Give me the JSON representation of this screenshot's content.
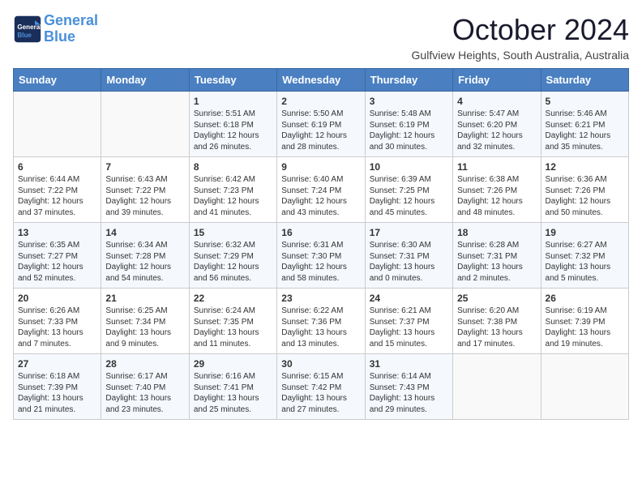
{
  "logo": {
    "line1": "General",
    "line2": "Blue"
  },
  "title": "October 2024",
  "subtitle": "Gulfview Heights, South Australia, Australia",
  "days_of_week": [
    "Sunday",
    "Monday",
    "Tuesday",
    "Wednesday",
    "Thursday",
    "Friday",
    "Saturday"
  ],
  "weeks": [
    [
      {
        "day": "",
        "info": ""
      },
      {
        "day": "",
        "info": ""
      },
      {
        "day": "1",
        "info": "Sunrise: 5:51 AM\nSunset: 6:18 PM\nDaylight: 12 hours\nand 26 minutes."
      },
      {
        "day": "2",
        "info": "Sunrise: 5:50 AM\nSunset: 6:19 PM\nDaylight: 12 hours\nand 28 minutes."
      },
      {
        "day": "3",
        "info": "Sunrise: 5:48 AM\nSunset: 6:19 PM\nDaylight: 12 hours\nand 30 minutes."
      },
      {
        "day": "4",
        "info": "Sunrise: 5:47 AM\nSunset: 6:20 PM\nDaylight: 12 hours\nand 32 minutes."
      },
      {
        "day": "5",
        "info": "Sunrise: 5:46 AM\nSunset: 6:21 PM\nDaylight: 12 hours\nand 35 minutes."
      }
    ],
    [
      {
        "day": "6",
        "info": "Sunrise: 6:44 AM\nSunset: 7:22 PM\nDaylight: 12 hours\nand 37 minutes."
      },
      {
        "day": "7",
        "info": "Sunrise: 6:43 AM\nSunset: 7:22 PM\nDaylight: 12 hours\nand 39 minutes."
      },
      {
        "day": "8",
        "info": "Sunrise: 6:42 AM\nSunset: 7:23 PM\nDaylight: 12 hours\nand 41 minutes."
      },
      {
        "day": "9",
        "info": "Sunrise: 6:40 AM\nSunset: 7:24 PM\nDaylight: 12 hours\nand 43 minutes."
      },
      {
        "day": "10",
        "info": "Sunrise: 6:39 AM\nSunset: 7:25 PM\nDaylight: 12 hours\nand 45 minutes."
      },
      {
        "day": "11",
        "info": "Sunrise: 6:38 AM\nSunset: 7:26 PM\nDaylight: 12 hours\nand 48 minutes."
      },
      {
        "day": "12",
        "info": "Sunrise: 6:36 AM\nSunset: 7:26 PM\nDaylight: 12 hours\nand 50 minutes."
      }
    ],
    [
      {
        "day": "13",
        "info": "Sunrise: 6:35 AM\nSunset: 7:27 PM\nDaylight: 12 hours\nand 52 minutes."
      },
      {
        "day": "14",
        "info": "Sunrise: 6:34 AM\nSunset: 7:28 PM\nDaylight: 12 hours\nand 54 minutes."
      },
      {
        "day": "15",
        "info": "Sunrise: 6:32 AM\nSunset: 7:29 PM\nDaylight: 12 hours\nand 56 minutes."
      },
      {
        "day": "16",
        "info": "Sunrise: 6:31 AM\nSunset: 7:30 PM\nDaylight: 12 hours\nand 58 minutes."
      },
      {
        "day": "17",
        "info": "Sunrise: 6:30 AM\nSunset: 7:31 PM\nDaylight: 13 hours\nand 0 minutes."
      },
      {
        "day": "18",
        "info": "Sunrise: 6:28 AM\nSunset: 7:31 PM\nDaylight: 13 hours\nand 2 minutes."
      },
      {
        "day": "19",
        "info": "Sunrise: 6:27 AM\nSunset: 7:32 PM\nDaylight: 13 hours\nand 5 minutes."
      }
    ],
    [
      {
        "day": "20",
        "info": "Sunrise: 6:26 AM\nSunset: 7:33 PM\nDaylight: 13 hours\nand 7 minutes."
      },
      {
        "day": "21",
        "info": "Sunrise: 6:25 AM\nSunset: 7:34 PM\nDaylight: 13 hours\nand 9 minutes."
      },
      {
        "day": "22",
        "info": "Sunrise: 6:24 AM\nSunset: 7:35 PM\nDaylight: 13 hours\nand 11 minutes."
      },
      {
        "day": "23",
        "info": "Sunrise: 6:22 AM\nSunset: 7:36 PM\nDaylight: 13 hours\nand 13 minutes."
      },
      {
        "day": "24",
        "info": "Sunrise: 6:21 AM\nSunset: 7:37 PM\nDaylight: 13 hours\nand 15 minutes."
      },
      {
        "day": "25",
        "info": "Sunrise: 6:20 AM\nSunset: 7:38 PM\nDaylight: 13 hours\nand 17 minutes."
      },
      {
        "day": "26",
        "info": "Sunrise: 6:19 AM\nSunset: 7:39 PM\nDaylight: 13 hours\nand 19 minutes."
      }
    ],
    [
      {
        "day": "27",
        "info": "Sunrise: 6:18 AM\nSunset: 7:39 PM\nDaylight: 13 hours\nand 21 minutes."
      },
      {
        "day": "28",
        "info": "Sunrise: 6:17 AM\nSunset: 7:40 PM\nDaylight: 13 hours\nand 23 minutes."
      },
      {
        "day": "29",
        "info": "Sunrise: 6:16 AM\nSunset: 7:41 PM\nDaylight: 13 hours\nand 25 minutes."
      },
      {
        "day": "30",
        "info": "Sunrise: 6:15 AM\nSunset: 7:42 PM\nDaylight: 13 hours\nand 27 minutes."
      },
      {
        "day": "31",
        "info": "Sunrise: 6:14 AM\nSunset: 7:43 PM\nDaylight: 13 hours\nand 29 minutes."
      },
      {
        "day": "",
        "info": ""
      },
      {
        "day": "",
        "info": ""
      }
    ]
  ]
}
